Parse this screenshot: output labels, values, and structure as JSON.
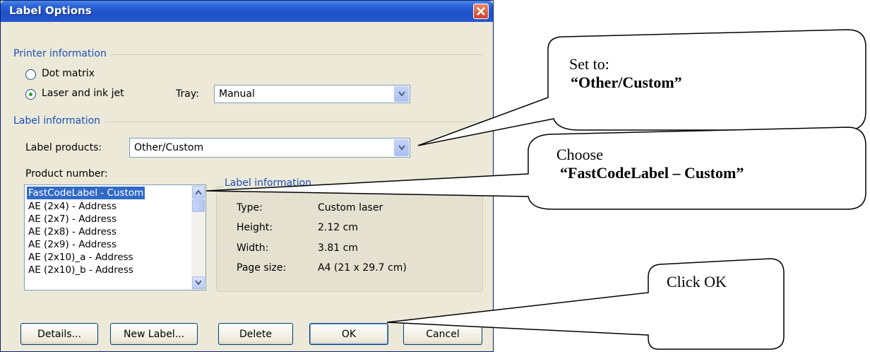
{
  "dialog": {
    "title": "Label Options",
    "printer_section": "Printer information",
    "radio_dot_matrix": "Dot matrix",
    "radio_laser": "Laser and ink jet",
    "tray_label": "Tray:",
    "tray_value": "Manual",
    "label_section": "Label information",
    "label_products_label": "Label products:",
    "label_products_value": "Other/Custom",
    "product_number_label": "Product number:",
    "products": [
      "FastCodeLabel - Custom",
      "AE (2x4) - Address",
      "AE (2x7) - Address",
      "AE (2x8) - Address",
      "AE (2x9) - Address",
      "AE (2x10)_a - Address",
      "AE (2x10)_b - Address"
    ],
    "info_group_title": "Label information",
    "info": {
      "type_label": "Type:",
      "type_value": "Custom laser",
      "height_label": "Height:",
      "height_value": "2.12 cm",
      "width_label": "Width:",
      "width_value": "3.81 cm",
      "page_label": "Page size:",
      "page_value": "A4 (21 x 29.7 cm)"
    },
    "buttons": {
      "details": "Details...",
      "new_label": "New Label...",
      "delete": "Delete",
      "ok": "OK",
      "cancel": "Cancel"
    }
  },
  "callouts": {
    "set_to_line1": "Set to:",
    "set_to_line2": "“Other/Custom”",
    "choose_line1": "Choose",
    "choose_line2": "“FastCodeLabel – Custom”",
    "click_ok": "Click OK"
  },
  "colors": {
    "titlebar": "#2b63d8",
    "dialog_bg": "#ece9d8",
    "section_text": "#1c4fb8",
    "selection": "#316ac5"
  }
}
